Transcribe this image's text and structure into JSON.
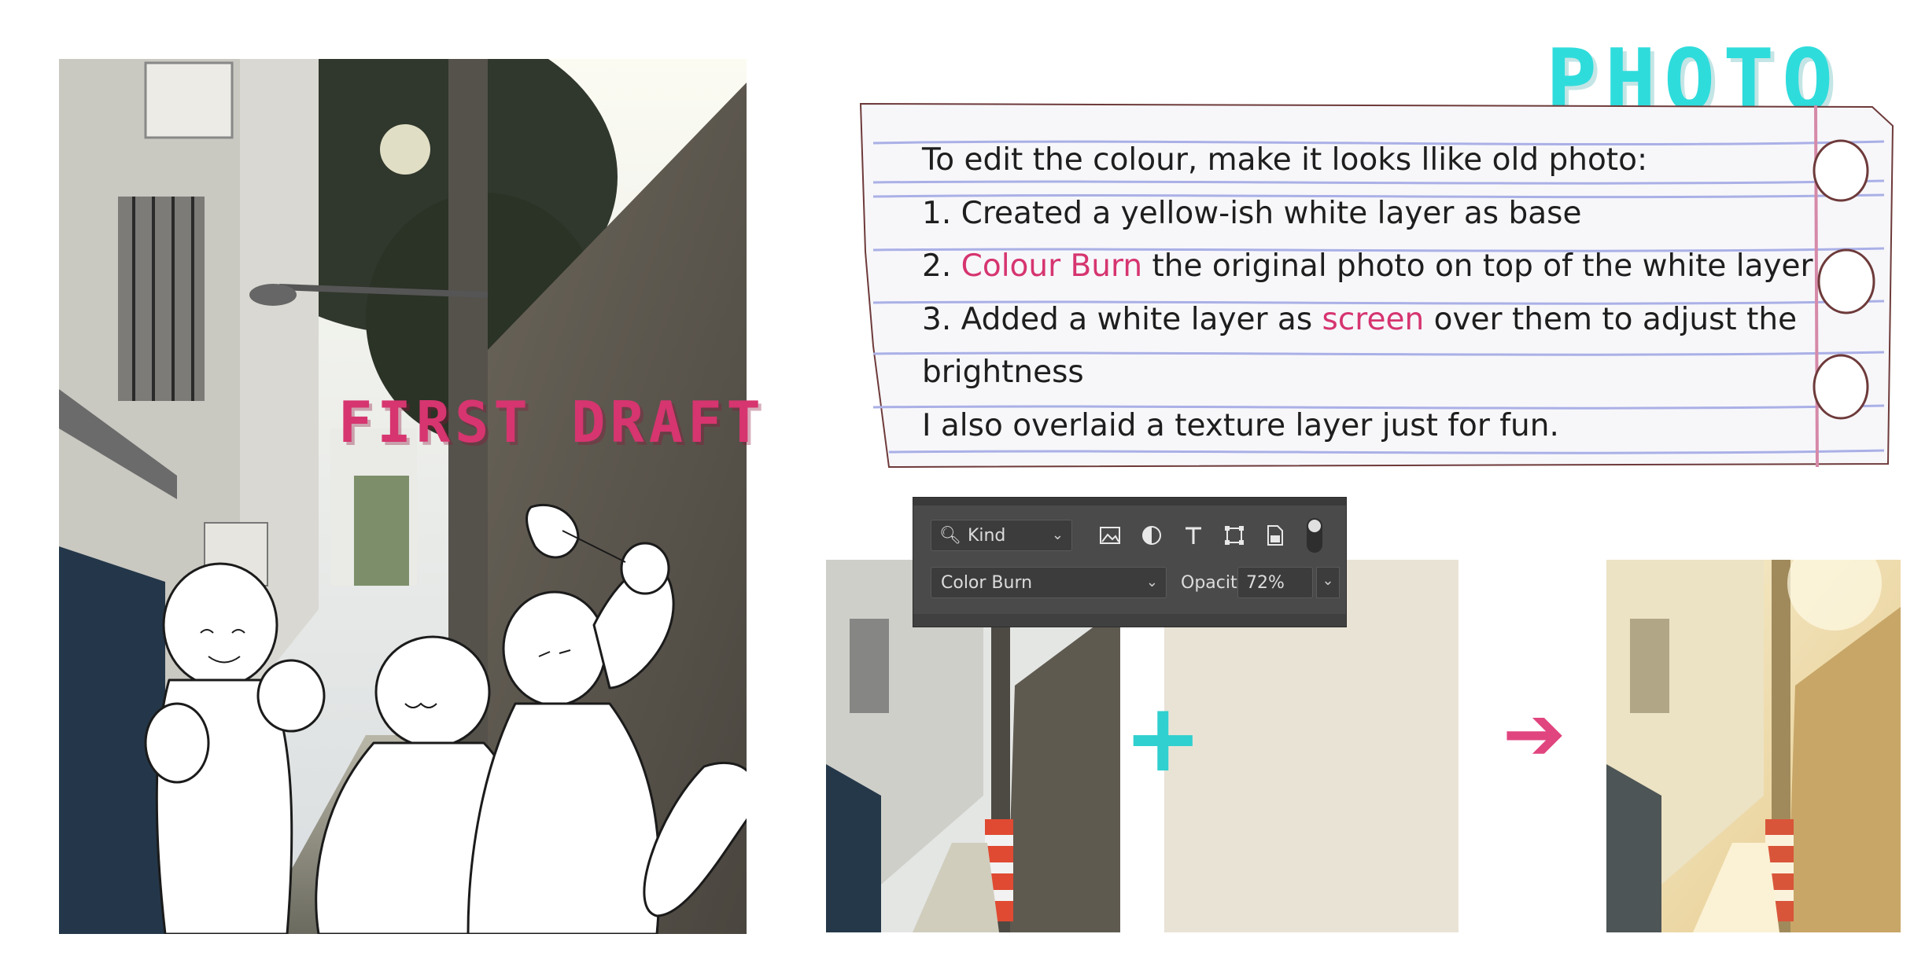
{
  "headings": {
    "photo": "PHOTO",
    "first_draft": "FIRST DRAFT"
  },
  "note": {
    "line1": "To edit the colour, make it looks llike old photo:",
    "line2": "1. Created a yellow-ish white layer as base",
    "line3_prefix": "2. ",
    "line3_highlight": "Colour Burn",
    "line3_suffix": " the original photo on top of the white layer",
    "line4_prefix": "3. Added a white layer as ",
    "line4_highlight": "screen",
    "line4_suffix": " over them to adjust the",
    "line5": "brightness",
    "line6": "I also overlaid a texture layer just for fun."
  },
  "layers_panel": {
    "kind_label": "Kind",
    "blend_mode": "Color Burn",
    "opacity_label": "Opacity:",
    "opacity_value": "72%"
  },
  "operators": {
    "plus": "+",
    "arrow": "➔"
  },
  "colors": {
    "accent_pink": "#d6356f",
    "accent_cyan": "#2fdcdc",
    "paper_line": "#9a9fe0",
    "panel_bg": "#4a4a4a",
    "beige_layer": "#e9e3d6"
  }
}
